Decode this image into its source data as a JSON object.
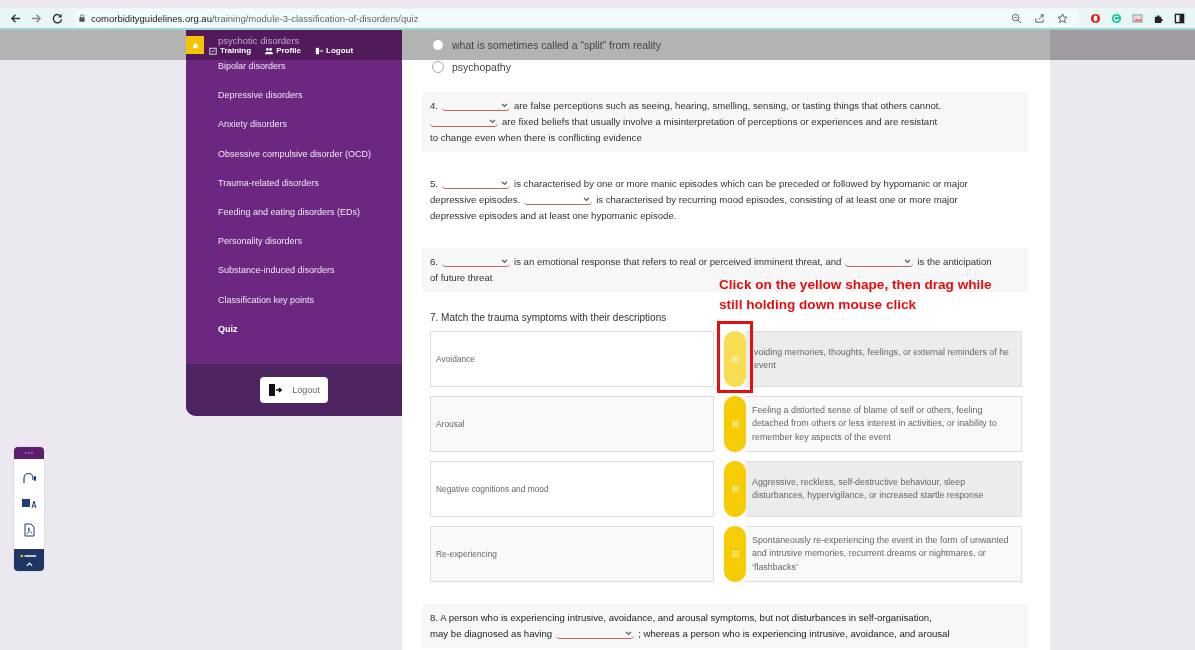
{
  "browser": {
    "url_host": "comorbidityguidelines.org.au",
    "url_path": "/training/module-3-classification-of-disorders/quiz"
  },
  "header": {
    "nav": [
      {
        "kind": "training",
        "label": "Training"
      },
      {
        "kind": "profile",
        "label": "Profile"
      },
      {
        "kind": "logout",
        "label": "Logout"
      }
    ]
  },
  "sidebar": {
    "items": [
      {
        "label": "psychotic disorders",
        "selected": false
      },
      {
        "label": "Bipolar disorders",
        "selected": false
      },
      {
        "label": "Depressive disorders",
        "selected": false
      },
      {
        "label": "Anxiety disorders",
        "selected": false
      },
      {
        "label": "Obsessive compulsive disorder (OCD)",
        "selected": false
      },
      {
        "label": "Trauma-related disorders",
        "selected": false
      },
      {
        "label": "Feeding and eating disorders (EDs)",
        "selected": false
      },
      {
        "label": "Personality disorders",
        "selected": false
      },
      {
        "label": "Substance-induced disorders",
        "selected": false
      },
      {
        "label": "Classification key points",
        "selected": false
      },
      {
        "label": "Quiz",
        "selected": true
      }
    ],
    "logout_button": "Logout"
  },
  "quiz": {
    "options": [
      {
        "label": "what is sometimes called a “split” from reality",
        "checked": false
      },
      {
        "label": "psychopathy",
        "checked": false
      }
    ],
    "questions": [
      {
        "lines": [
          [
            {
              "kind": "text",
              "text": "4."
            },
            {
              "kind": "blank"
            },
            {
              "kind": "text",
              "text": "are false perceptions such as seeing, hearing, smelling, sensing, or tasting things that others cannot."
            }
          ],
          [
            {
              "kind": "blank"
            },
            {
              "kind": "text",
              "text": "are fixed beliefs that usually involve a misinterpretation of perceptions or experiences and are resistant"
            }
          ],
          [
            {
              "kind": "text",
              "text": "to change even when there is conflicting evidence"
            }
          ]
        ]
      },
      {
        "lines": [
          [
            {
              "kind": "text",
              "text": "5."
            },
            {
              "kind": "blank"
            },
            {
              "kind": "text",
              "text": "is characterised by one or more manic episodes which can be preceded or followed by hypomanic or major"
            }
          ],
          [
            {
              "kind": "text",
              "text": "depressive episodes."
            },
            {
              "kind": "blank"
            },
            {
              "kind": "text",
              "text": "is characterised by recurring mood episodes, consisting of at least one or more major"
            }
          ],
          [
            {
              "kind": "text",
              "text": "depressive episodes and at least one hypomanic episode."
            }
          ]
        ]
      },
      {
        "lines": [
          [
            {
              "kind": "text",
              "text": "6."
            },
            {
              "kind": "blank"
            },
            {
              "kind": "text",
              "text": "is an emotional response that refers to real or perceived imminent threat, and"
            },
            {
              "kind": "blank"
            },
            {
              "kind": "text",
              "text": "is the anticipation"
            }
          ],
          [
            {
              "kind": "text",
              "text": "of future threat"
            }
          ]
        ]
      }
    ],
    "matching": {
      "title": "7. Match the trauma symptoms with their descriptions",
      "rows": [
        {
          "term": "Avoidance",
          "description": "voiding memories, thoughts, feelings, or external reminders of he event",
          "dragging": true
        },
        {
          "term": "Arousal",
          "description": "Feeling a distorted sense of blame of self or others, feeling detached from others or less interest in activities, or inability to remember key aspects of the event",
          "dragging": false
        },
        {
          "term": "Negative cognitions and mood",
          "description": "Aggressive, reckless, self-destructive behaviour, sleep disturbances, hypervigilance, or increased startle response",
          "dragging": false
        },
        {
          "term": "Re-experiencing",
          "description": "Spontaneously re-experiencing the event in the form of unwanted and intrusive memories, recurrent dreams or nightmares, or ‘flashbacks’",
          "dragging": false
        }
      ]
    },
    "last_question": {
      "lines": [
        [
          {
            "kind": "text",
            "text": "8. A person who is experiencing intrusive, avoidance, and arousal symptoms, but not disturbances in self-organisation,"
          }
        ],
        [
          {
            "kind": "text",
            "text": "may be diagnosed as having"
          },
          {
            "kind": "blank"
          },
          {
            "kind": "text",
            "text": "; whereas a person who is experiencing intrusive, avoidance, and arousal"
          }
        ]
      ]
    }
  },
  "annotation": {
    "text": "Click on the yellow shape, then drag while still holding down mouse click"
  }
}
